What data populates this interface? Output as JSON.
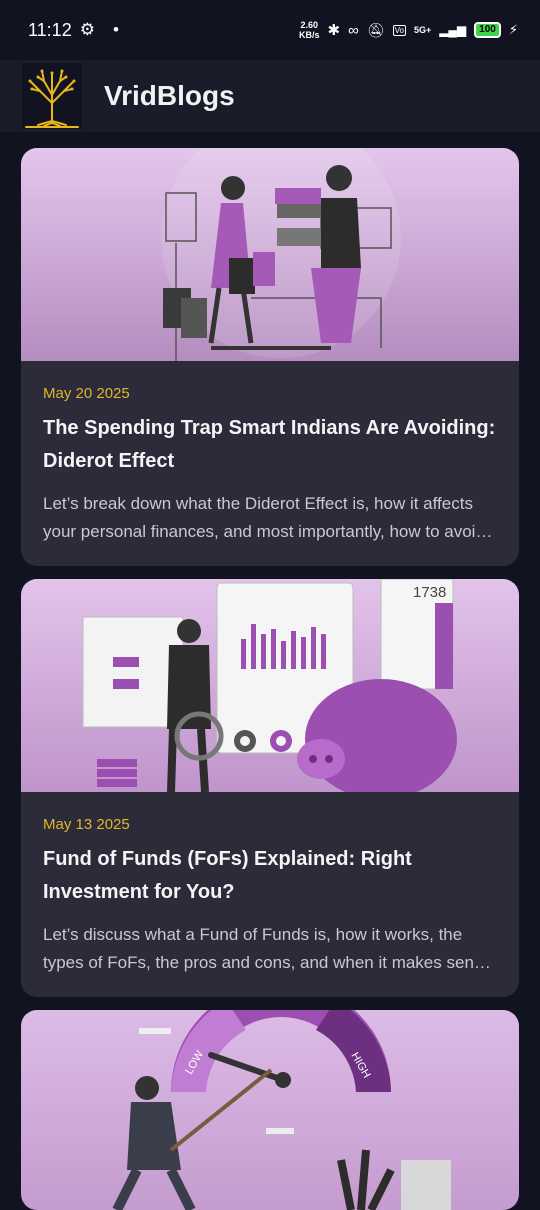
{
  "status": {
    "time": "11:12",
    "net_speed_value": "2.60",
    "net_speed_unit": "KB/s",
    "network": "5G+",
    "battery": "100"
  },
  "app": {
    "title": "VridBlogs"
  },
  "posts": [
    {
      "date": "May 20 2025",
      "title": "The Spending Trap Smart Indians Are Avoiding: Diderot Effect",
      "excerpt": "Let’s break down what the Diderot Effect is, how it affects your personal finances, and most importantly, how to avoid it."
    },
    {
      "date": "May 13 2025",
      "title": "Fund of Funds (FoFs) Explained: Right Investment for You?",
      "excerpt": "Let’s discuss what a Fund of Funds is, how it works, the types of FoFs, the pros and cons, and when it makes sense to invest."
    }
  ],
  "illustration_text": {
    "calc_display": "1738",
    "gauge_low": "LOW",
    "gauge_high": "HIGH"
  },
  "colors": {
    "background": "#121320",
    "card": "#2b2b3a",
    "accent_date": "#e0b62a",
    "purple": "#9b4fb0"
  }
}
